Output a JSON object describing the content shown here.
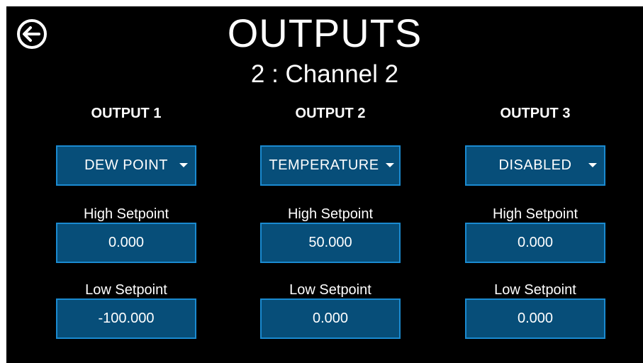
{
  "header": {
    "title": "OUTPUTS",
    "subtitle": "2 : Channel 2",
    "back_icon": "back-arrow-circle-icon"
  },
  "labels": {
    "high_setpoint": "High Setpoint",
    "low_setpoint": "Low Setpoint"
  },
  "outputs": [
    {
      "header": "OUTPUT 1",
      "mode": "DEW POINT",
      "high_setpoint": "0.000",
      "low_setpoint": "-100.000"
    },
    {
      "header": "OUTPUT 2",
      "mode": "TEMPERATURE",
      "high_setpoint": "50.000",
      "low_setpoint": "0.000"
    },
    {
      "header": "OUTPUT 3",
      "mode": "DISABLED",
      "high_setpoint": "0.000",
      "low_setpoint": "0.000"
    }
  ],
  "colors": {
    "background": "#000000",
    "field_fill": "#074e79",
    "field_border": "#1a8ad0",
    "text": "#ffffff"
  }
}
